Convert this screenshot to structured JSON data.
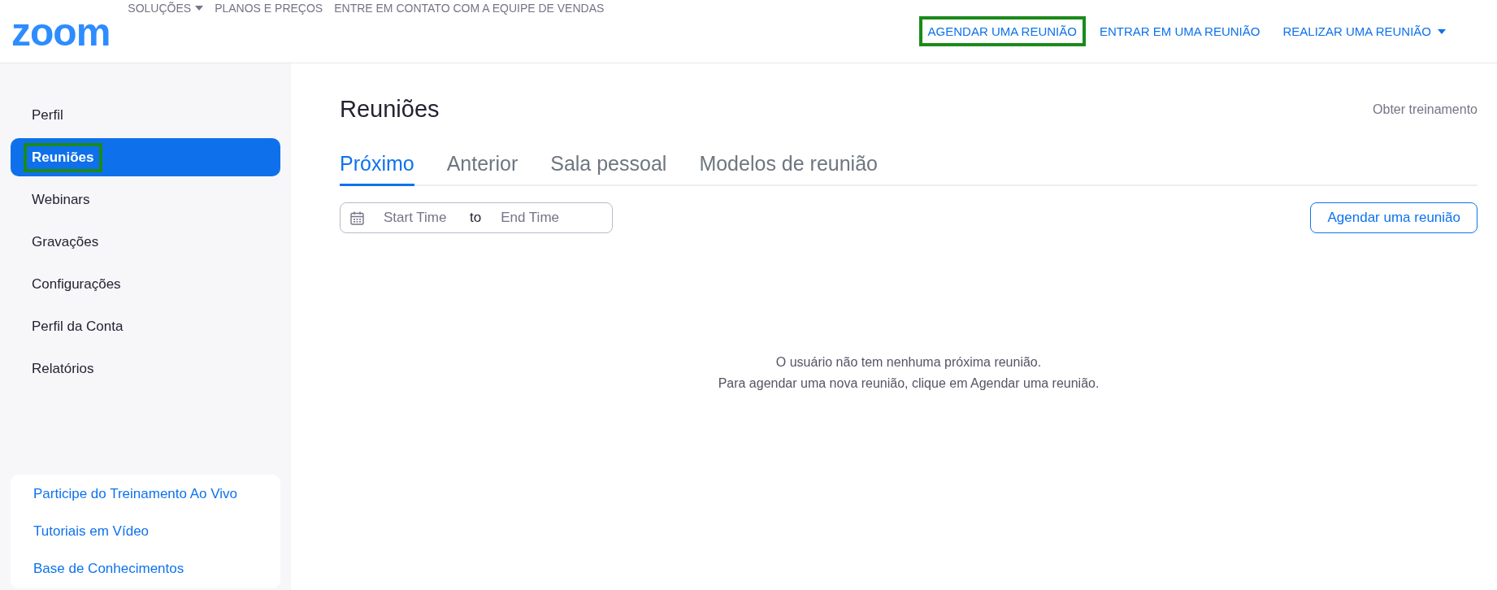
{
  "header": {
    "logo": "zoom",
    "nav_left": [
      {
        "label": "SOLUÇÕES",
        "dropdown": true
      },
      {
        "label": "PLANOS E PREÇOS",
        "dropdown": false
      },
      {
        "label": "ENTRE EM CONTATO COM A EQUIPE DE VENDAS",
        "dropdown": false
      }
    ],
    "nav_right": [
      {
        "label": "AGENDAR UMA REUNIÃO",
        "dropdown": false,
        "highlighted": true
      },
      {
        "label": "ENTRAR EM UMA REUNIÃO",
        "dropdown": false,
        "highlighted": false
      },
      {
        "label": "REALIZAR UMA REUNIÃO",
        "dropdown": true,
        "highlighted": false
      }
    ]
  },
  "sidebar": {
    "items": [
      {
        "label": "Perfil",
        "selected": false,
        "highlighted": false
      },
      {
        "label": "Reuniões",
        "selected": true,
        "highlighted": true
      },
      {
        "label": "Webinars",
        "selected": false,
        "highlighted": false
      },
      {
        "label": "Gravações",
        "selected": false,
        "highlighted": false
      },
      {
        "label": "Configurações",
        "selected": false,
        "highlighted": false
      },
      {
        "label": "Perfil da Conta",
        "selected": false,
        "highlighted": false
      },
      {
        "label": "Relatórios",
        "selected": false,
        "highlighted": false
      }
    ],
    "links": [
      "Participe do Treinamento Ao Vivo",
      "Tutoriais em Vídeo",
      "Base de Conhecimentos"
    ]
  },
  "main": {
    "title": "Reuniões",
    "training_link": "Obter treinamento",
    "tabs": [
      {
        "label": "Próximo",
        "selected": true
      },
      {
        "label": "Anterior",
        "selected": false
      },
      {
        "label": "Sala pessoal",
        "selected": false
      },
      {
        "label": "Modelos de reunião",
        "selected": false
      }
    ],
    "date_range": {
      "start_placeholder": "Start Time",
      "separator": "to",
      "end_placeholder": "End Time"
    },
    "schedule_button": "Agendar uma reunião",
    "empty_message": [
      "O usuário não tem nenhuma próxima reunião.",
      "Para agendar uma nova reunião, clique em Agendar uma reunião."
    ]
  }
}
